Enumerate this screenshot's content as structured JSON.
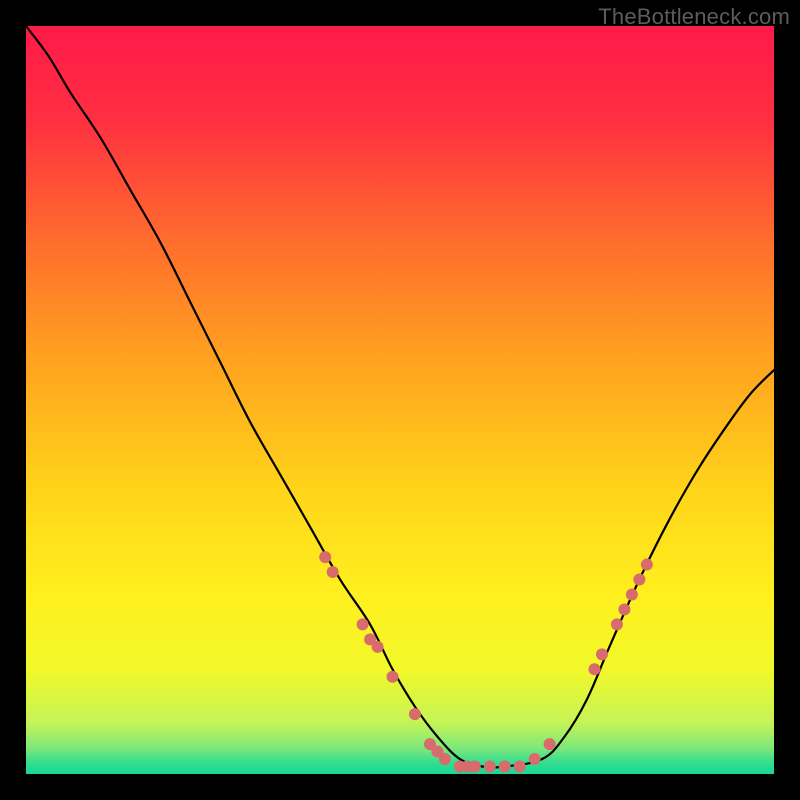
{
  "watermark": "TheBottleneck.com",
  "gradient": {
    "stops": [
      {
        "offset": 0.0,
        "color": "#ff1a49"
      },
      {
        "offset": 0.12,
        "color": "#ff2e42"
      },
      {
        "offset": 0.28,
        "color": "#ff6a2e"
      },
      {
        "offset": 0.45,
        "color": "#ffa31f"
      },
      {
        "offset": 0.62,
        "color": "#ffd41a"
      },
      {
        "offset": 0.76,
        "color": "#fff01e"
      },
      {
        "offset": 0.86,
        "color": "#f2f82a"
      },
      {
        "offset": 0.93,
        "color": "#c6f455"
      },
      {
        "offset": 0.965,
        "color": "#7fe87a"
      },
      {
        "offset": 0.985,
        "color": "#34dd90"
      },
      {
        "offset": 1.0,
        "color": "#16d893"
      }
    ]
  },
  "chart_data": {
    "type": "line",
    "title": "",
    "xlabel": "",
    "ylabel": "",
    "xlim": [
      0,
      100
    ],
    "ylim": [
      0,
      100
    ],
    "series": [
      {
        "name": "curve",
        "x": [
          0,
          3,
          6,
          10,
          14,
          18,
          22,
          26,
          30,
          34,
          38,
          42,
          46,
          49,
          52,
          55,
          58,
          61,
          64,
          69,
          72,
          75,
          78,
          82,
          86,
          90,
          94,
          97,
          100
        ],
        "values": [
          100,
          96,
          91,
          85,
          78,
          71,
          63,
          55,
          47,
          40,
          33,
          26,
          20,
          14,
          9,
          5,
          2,
          1,
          1,
          2,
          5,
          10,
          17,
          26,
          34,
          41,
          47,
          51,
          54
        ]
      }
    ],
    "markers": {
      "name": "highlight-dots",
      "color": "#d86b6b",
      "radius_px": 6,
      "points": [
        {
          "x": 40,
          "y": 29
        },
        {
          "x": 41,
          "y": 27
        },
        {
          "x": 45,
          "y": 20
        },
        {
          "x": 46,
          "y": 18
        },
        {
          "x": 47,
          "y": 17
        },
        {
          "x": 49,
          "y": 13
        },
        {
          "x": 52,
          "y": 8
        },
        {
          "x": 54,
          "y": 4
        },
        {
          "x": 55,
          "y": 3
        },
        {
          "x": 56,
          "y": 2
        },
        {
          "x": 58,
          "y": 1
        },
        {
          "x": 59,
          "y": 1
        },
        {
          "x": 60,
          "y": 1
        },
        {
          "x": 62,
          "y": 1
        },
        {
          "x": 64,
          "y": 1
        },
        {
          "x": 66,
          "y": 1
        },
        {
          "x": 68,
          "y": 2
        },
        {
          "x": 70,
          "y": 4
        },
        {
          "x": 76,
          "y": 14
        },
        {
          "x": 77,
          "y": 16
        },
        {
          "x": 79,
          "y": 20
        },
        {
          "x": 80,
          "y": 22
        },
        {
          "x": 81,
          "y": 24
        },
        {
          "x": 82,
          "y": 26
        },
        {
          "x": 83,
          "y": 28
        }
      ]
    }
  }
}
